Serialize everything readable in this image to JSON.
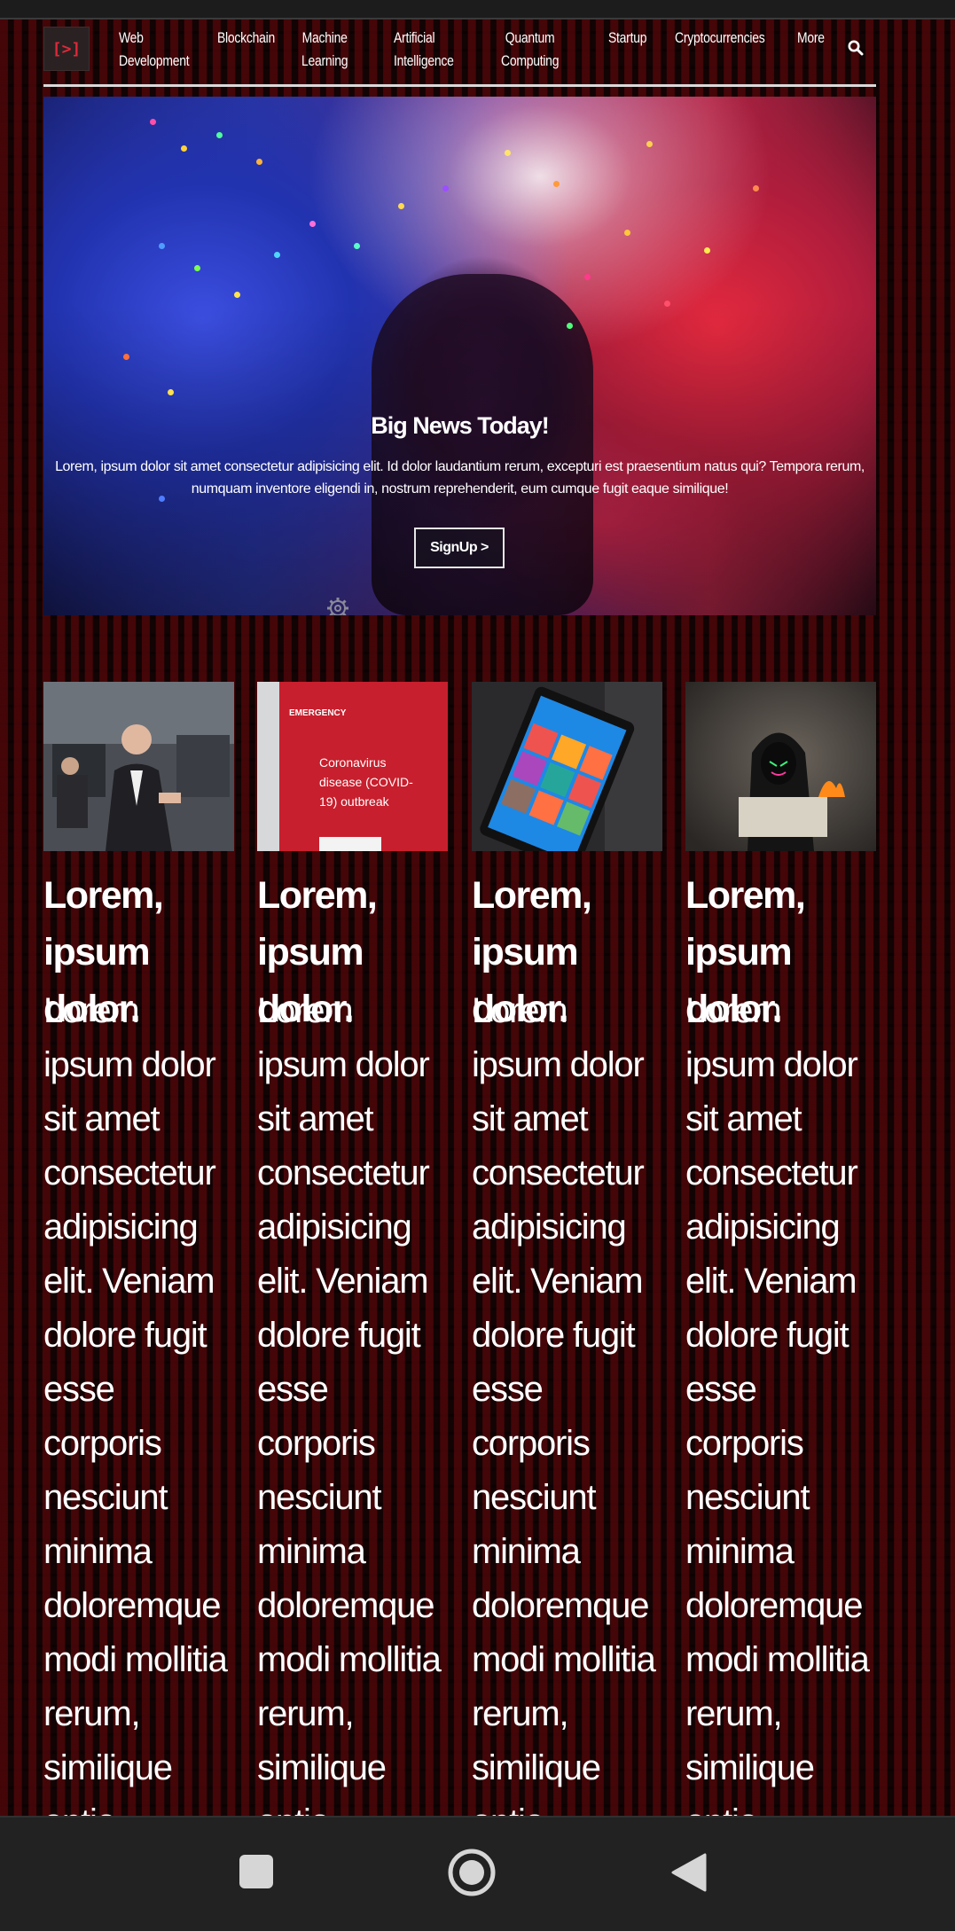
{
  "logo": {
    "text": "[>]"
  },
  "nav": {
    "items": [
      {
        "label": "Web\nDevelopment"
      },
      {
        "label": "Blockchain"
      },
      {
        "label": "Machine\nLearning"
      },
      {
        "label": "Artificial\nIntelligence"
      },
      {
        "label": "Quantum\nComputing"
      },
      {
        "label": "Startup"
      },
      {
        "label": "Cryptocurrencies"
      },
      {
        "label": "More"
      }
    ],
    "search_icon": "search-icon"
  },
  "hero": {
    "title": "Big News Today!",
    "text": "Lorem, ipsum dolor sit amet consectetur adipisicing elit. Id dolor laudantium rerum, excepturi est praesentium natus qui? Tempora rerum, numquam inventore eligendi in, nostrum reprehenderit, eum cumque fugit eaque similique!",
    "button_label": "SignUp >",
    "gear_icon": "gear-icon"
  },
  "cards": [
    {
      "image": "presenter-photo",
      "title": "Lorem, ipsum dolor.",
      "text": "Lorem ipsum dolor sit amet consectetur adipisicing elit. Veniam dolore fugit esse corporis nesciunt minima doloremque modi mollitia rerum, similique optio eligendi itaque amet qui ullam vel"
    },
    {
      "image": "emergency-sign-photo",
      "image_caption_label": "EMERGENCY",
      "image_caption_text": "Coronavirus disease (COVID-19) outbreak",
      "title": "Lorem, ipsum dolor.",
      "text": "Lorem ipsum dolor sit amet consectetur adipisicing elit. Veniam dolore fugit esse corporis nesciunt minima doloremque modi mollitia rerum, similique optio eligendi itaque amet qui ullam vel"
    },
    {
      "image": "tablet-photo",
      "title": "Lorem, ipsum dolor.",
      "text": "Lorem ipsum dolor sit amet consectetur adipisicing elit. Veniam dolore fugit esse corporis nesciunt minima doloremque modi mollitia rerum, similique optio eligendi itaque amet qui ullam vel"
    },
    {
      "image": "hooded-figure-photo",
      "title": "Lorem, ipsum dolor.",
      "text": "Lorem ipsum dolor sit amet consectetur adipisicing elit. Veniam dolore fugit esse corporis nesciunt minima doloremque modi mollitia rerum, similique optio eligendi itaque amet qui ullam vel"
    }
  ],
  "system_nav": {
    "recents_icon": "square-icon",
    "home_icon": "circle-icon",
    "back_icon": "triangle-back-icon"
  },
  "colors": {
    "background": "#120304",
    "accent": "#e0283a",
    "text": "#ffffff"
  }
}
